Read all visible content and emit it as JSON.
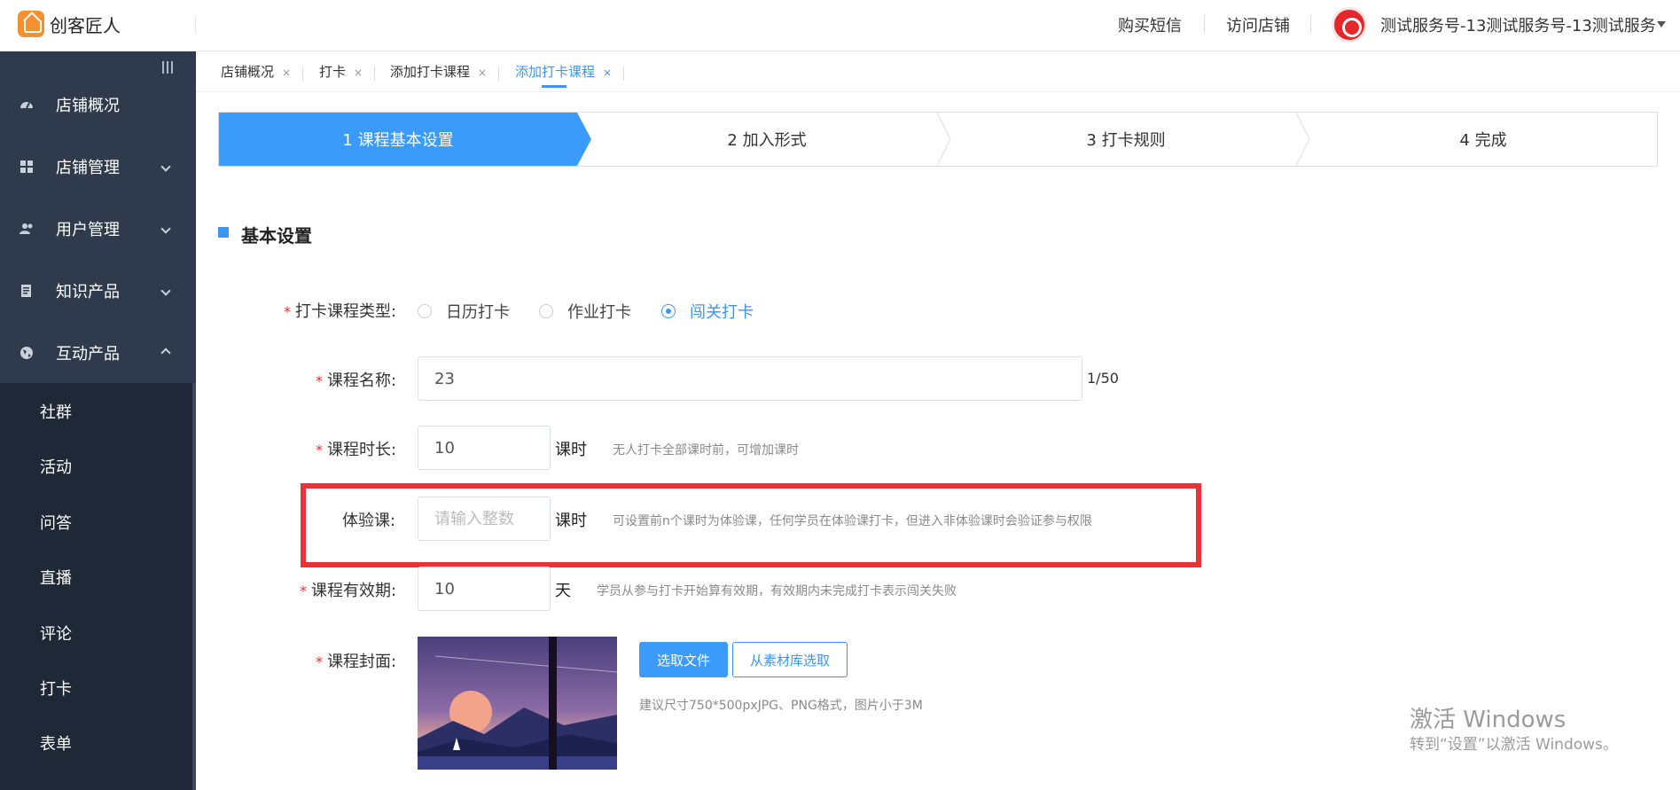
{
  "header": {
    "logo_text": "创客匠人",
    "links": [
      "购买短信",
      "访问店铺"
    ],
    "user_name": "测试服务号-13测试服务号-13测试服务"
  },
  "sidebar": {
    "items": [
      {
        "label": "店铺概况",
        "icon": "dashboard-icon"
      },
      {
        "label": "店铺管理",
        "icon": "grid-icon"
      },
      {
        "label": "用户管理",
        "icon": "users-icon"
      },
      {
        "label": "知识产品",
        "icon": "document-icon"
      },
      {
        "label": "互动产品",
        "icon": "globe-icon"
      }
    ],
    "subitems": [
      "社群",
      "活动",
      "问答",
      "直播",
      "评论",
      "打卡",
      "表单"
    ]
  },
  "tabs": [
    {
      "label": "店铺概况",
      "close": "×"
    },
    {
      "label": "打卡",
      "close": "×"
    },
    {
      "label": "添加打卡课程",
      "close": "×"
    },
    {
      "label": "添加打卡课程",
      "close": "×",
      "active": true
    }
  ],
  "steps": [
    "1 课程基本设置",
    "2 加入形式",
    "3 打卡规则",
    "4 完成"
  ],
  "section": {
    "title": "基本设置"
  },
  "form": {
    "required_mark": "*",
    "type_label": "打卡课程类型:",
    "type_options": [
      "日历打卡",
      "作业打卡",
      "闯关打卡"
    ],
    "type_selected": "闯关打卡",
    "name_label": "课程名称:",
    "name_value": "23",
    "name_counter": "1/50",
    "duration_label": "课程时长:",
    "duration_value": "10",
    "duration_unit": "课时",
    "duration_hint": "无人打卡全部课时前，可增加课时",
    "trial_label": "体验课:",
    "trial_placeholder": "请输入整数",
    "trial_unit": "课时",
    "trial_hint": "可设置前n个课时为体验课，任何学员在体验课打卡，但进入非体验课时会验证参与权限",
    "validity_label": "课程有效期:",
    "validity_value": "10",
    "validity_unit": "天",
    "validity_hint": "学员从参与打卡开始算有效期，有效期内未完成打卡表示闯关失败",
    "cover_label": "课程封面:",
    "cover_btn_file": "选取文件",
    "cover_btn_library": "从素材库选取",
    "cover_hint": "建议尺寸750*500pxJPG、PNG格式，图片小于3M"
  },
  "watermark": {
    "line1": "激活 Windows",
    "line2": "转到“设置”以激活 Windows。"
  },
  "colors": {
    "sidebar_bg": "#2f3b4c",
    "submenu_bg": "#1f2836",
    "accent": "#3a9bfb",
    "highlight": "#ef3137",
    "logo": "#f5902f"
  }
}
